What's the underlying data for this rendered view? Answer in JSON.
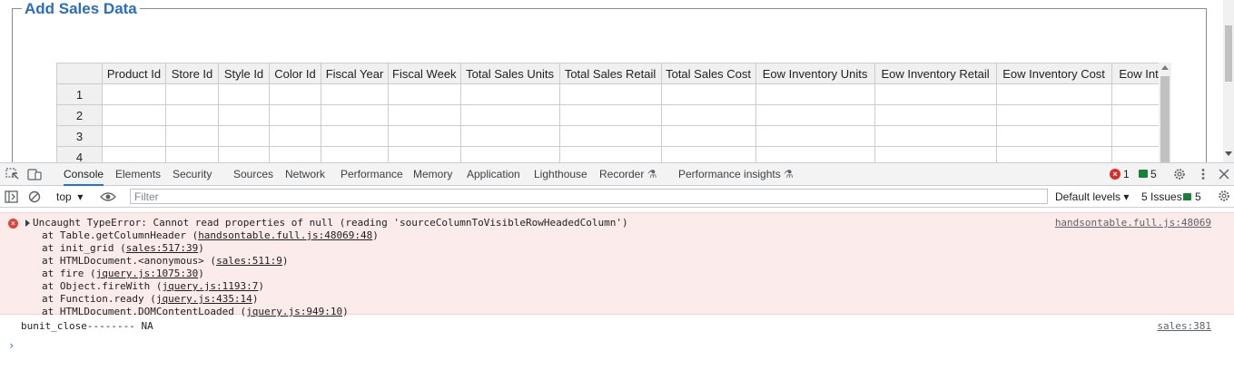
{
  "page": {
    "legend": "Add Sales Data",
    "grid": {
      "columns": [
        "Product Id",
        "Store Id",
        "Style Id",
        "Color Id",
        "Fiscal Year",
        "Fiscal Week",
        "Total Sales Units",
        "Total Sales Retail",
        "Total Sales Cost",
        "Eow Inventory Units",
        "Eow Inventory Retail",
        "Eow Inventory Cost",
        "Eow Int"
      ],
      "rows": [
        "1",
        "2",
        "3",
        "4"
      ]
    }
  },
  "devtools": {
    "tabs": [
      "Console",
      "Elements",
      "Security",
      "Sources",
      "Network",
      "Performance",
      "Memory",
      "Application",
      "Lighthouse",
      "Recorder",
      "Performance insights"
    ],
    "active_tab": "Console",
    "error_count": "1",
    "message_count": "5",
    "toolbar": {
      "context": "top",
      "filter_placeholder": "Filter",
      "levels": "Default levels",
      "issues_label": "5 Issues:",
      "issues_count": "5"
    },
    "error": {
      "message": "Uncaught TypeError: Cannot read properties of null (reading 'sourceColumnToVisibleRowHeadedColumn')",
      "source": "handsontable.full.js:48069",
      "stack": [
        {
          "fn": "at Table.getColumnHeader (",
          "link": "handsontable.full.js:48069:48",
          "end": ")"
        },
        {
          "fn": "at init_grid (",
          "link": "sales:517:39",
          "end": ")"
        },
        {
          "fn": "at HTMLDocument.<anonymous> (",
          "link": "sales:511:9",
          "end": ")"
        },
        {
          "fn": "at fire (",
          "link": "jquery.js:1075:30",
          "end": ")"
        },
        {
          "fn": "at Object.fireWith (",
          "link": "jquery.js:1193:7",
          "end": ")"
        },
        {
          "fn": "at Function.ready (",
          "link": "jquery.js:435:14",
          "end": ")"
        },
        {
          "fn": "at HTMLDocument.DOMContentLoaded (",
          "link": "jquery.js:949:10",
          "end": ")"
        }
      ]
    },
    "log": {
      "message": "bunit_close-------- NA",
      "source": "sales:381"
    }
  }
}
